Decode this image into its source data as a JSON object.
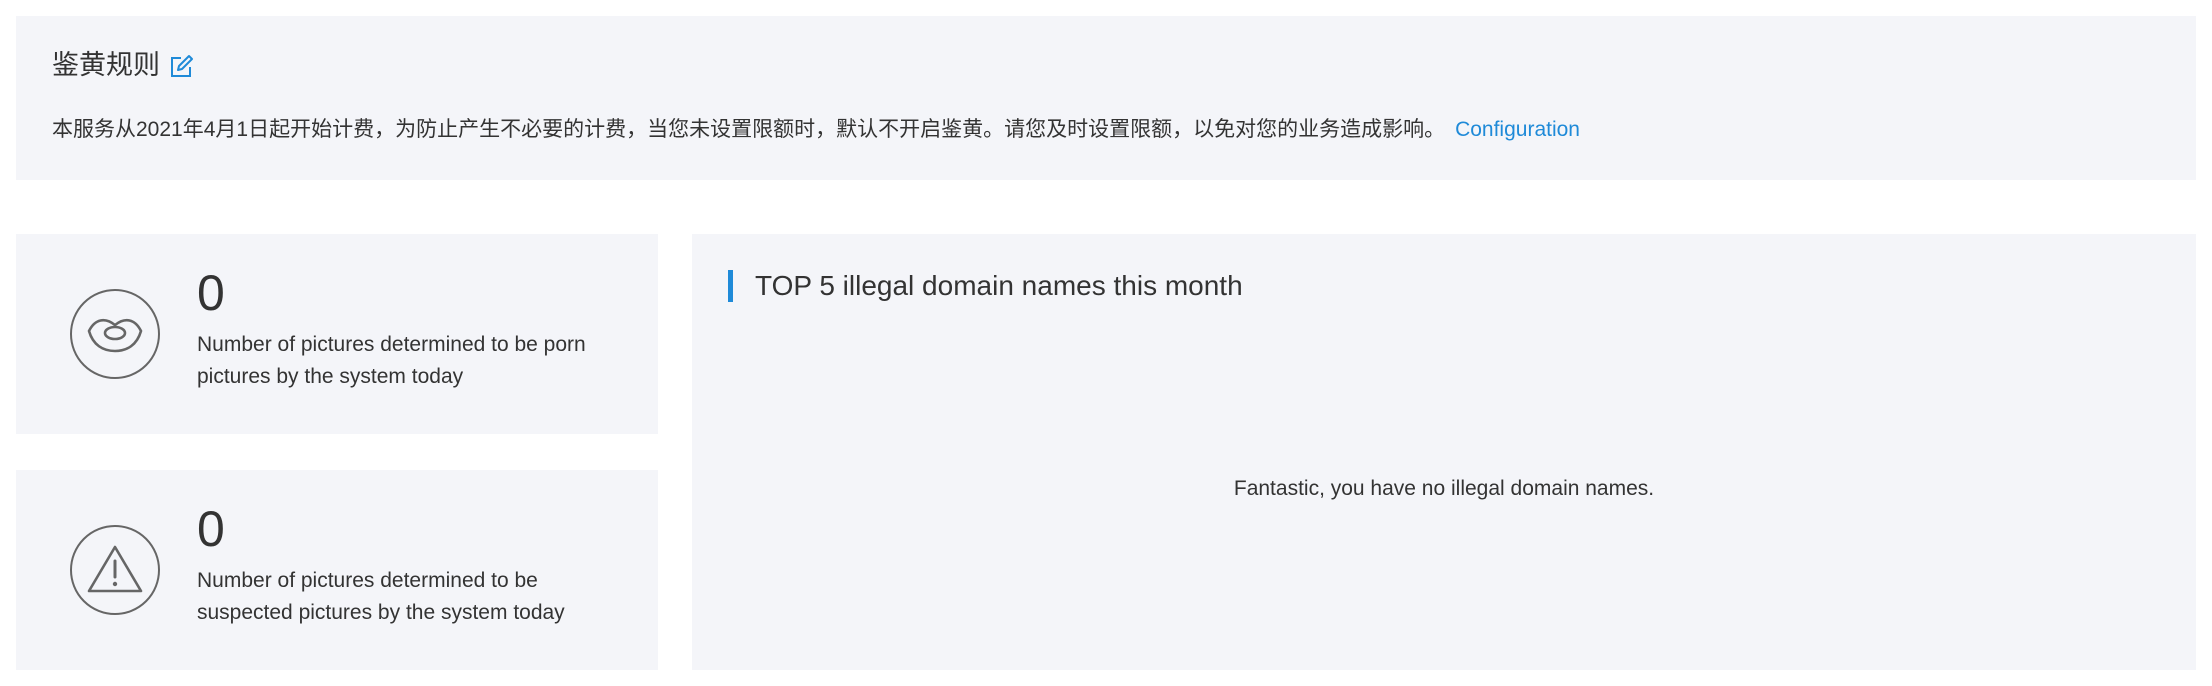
{
  "rules": {
    "title": "鉴黄规则",
    "description": "本服务从2021年4月1日起开始计费，为防止产生不必要的计费，当您未设置限额时，默认不开启鉴黄。请您及时设置限额，以免对您的业务造成影响。",
    "config_link": "Configuration",
    "edit_icon": "edit-icon"
  },
  "stats": {
    "porn": {
      "icon": "lips-icon",
      "value": "0",
      "label": "Number of pictures determined to be porn pictures by the system today"
    },
    "suspect": {
      "icon": "warning-icon",
      "value": "0",
      "label": "Number of pictures determined to be suspected pictures by the system today"
    }
  },
  "top_domains": {
    "title": "TOP 5 illegal domain names this month",
    "empty_message": "Fantastic, you have no illegal domain names."
  },
  "colors": {
    "accent": "#1f8ad8",
    "panel_bg": "#f4f5f9",
    "text": "#333333"
  }
}
